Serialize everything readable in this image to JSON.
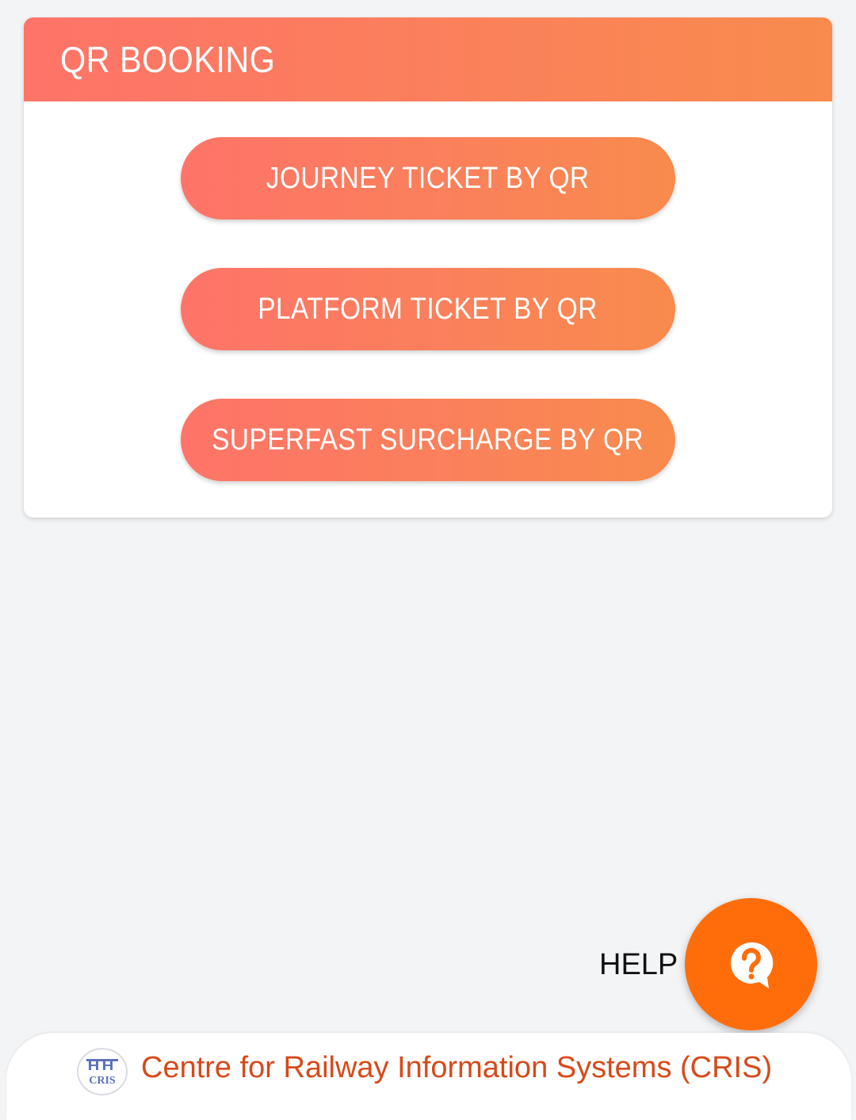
{
  "card": {
    "title": "QR BOOKING",
    "buttons": [
      {
        "label": "JOURNEY TICKET BY QR"
      },
      {
        "label": "PLATFORM TICKET BY QR"
      },
      {
        "label": "SUPERFAST SURCHARGE BY QR"
      }
    ]
  },
  "help": {
    "label": "HELP",
    "icon": "question-bubble-icon"
  },
  "footer": {
    "logo_text": "CRIS",
    "org_name": "Centre for Railway Information Systems (CRIS)"
  },
  "colors": {
    "gradient_start": "#fe7468",
    "gradient_end": "#f88b4d",
    "fab": "#fe6d0a",
    "footer_text": "#d64a1a",
    "background": "#f3f4f6"
  }
}
